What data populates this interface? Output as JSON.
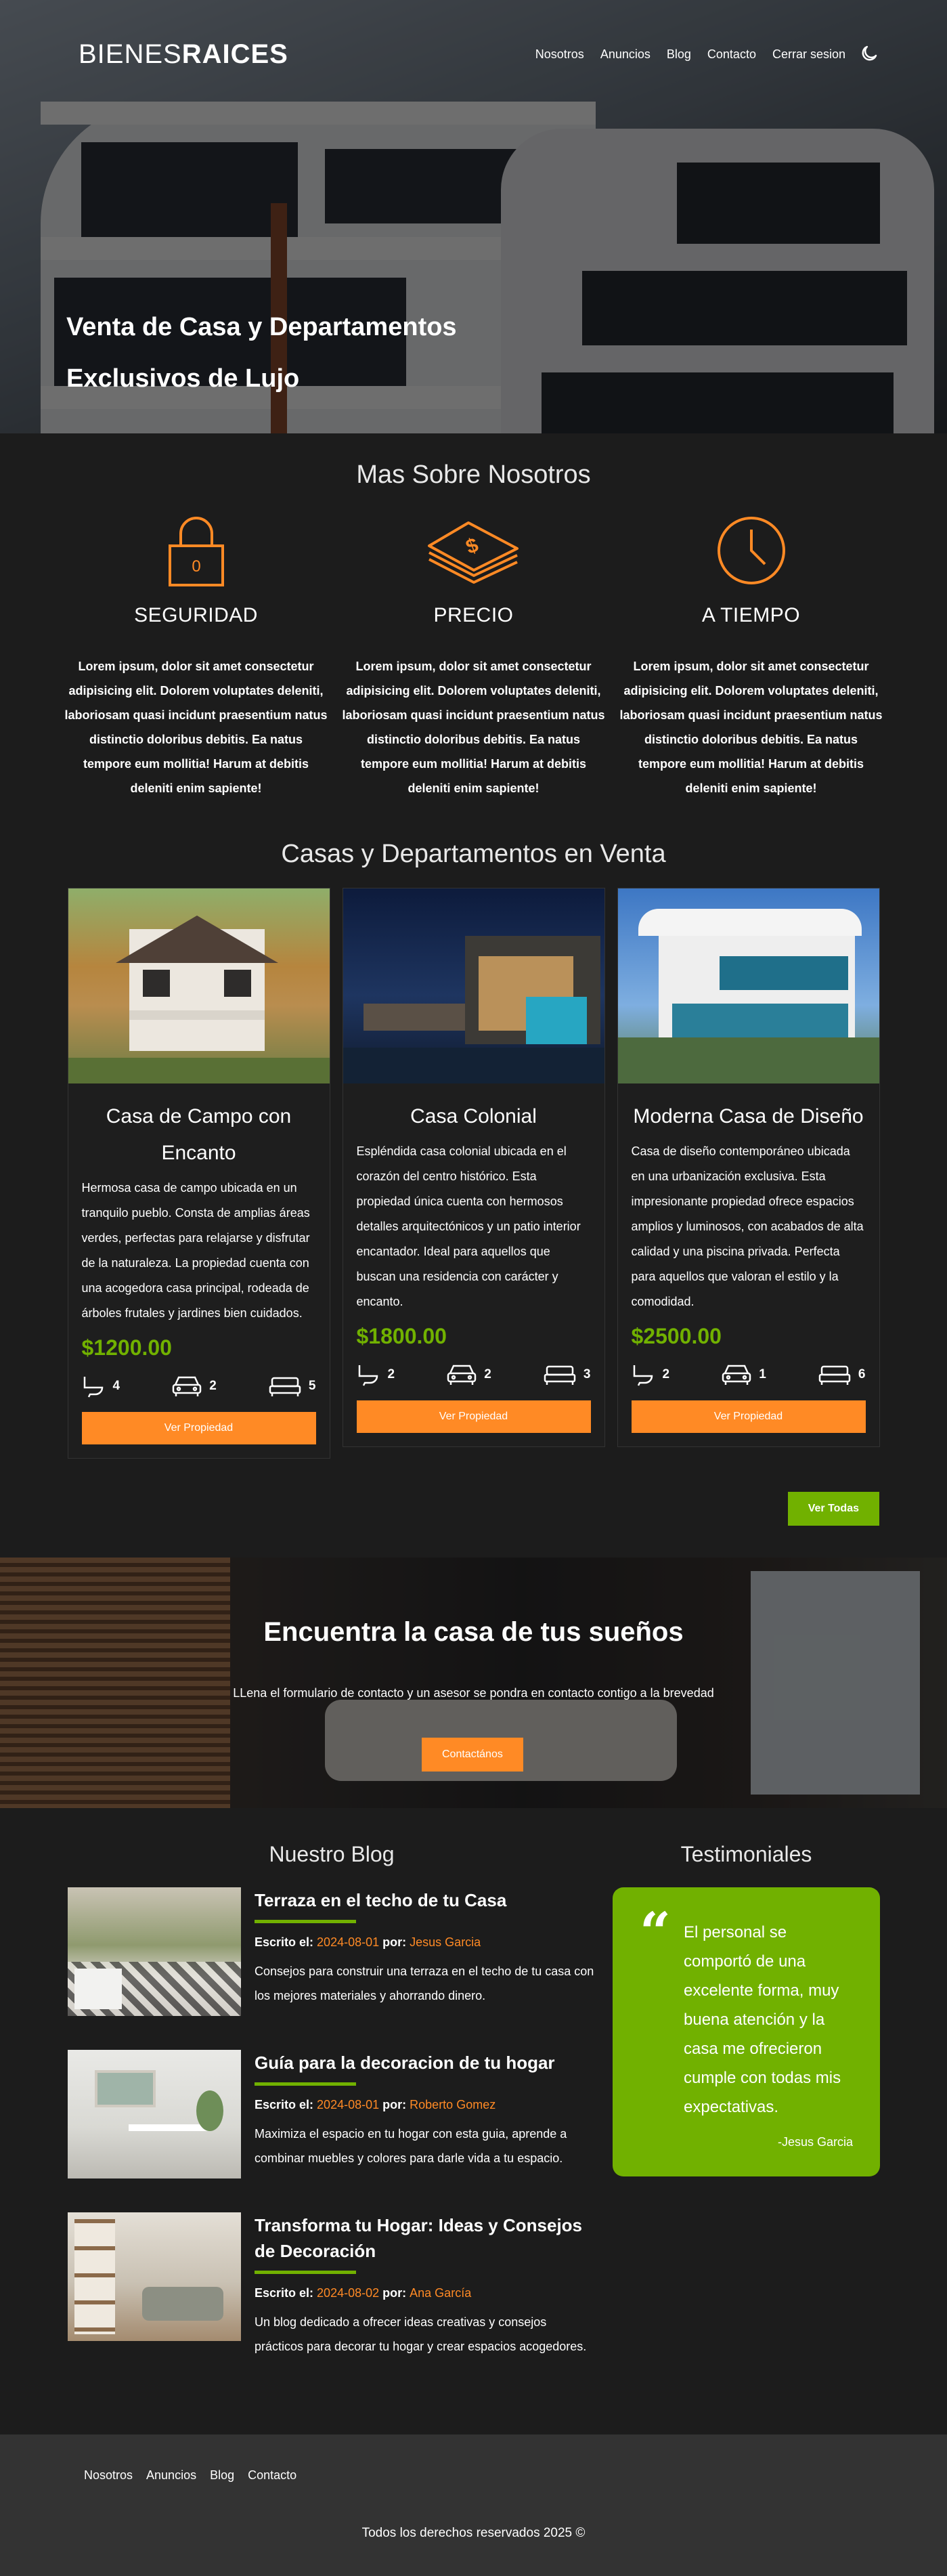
{
  "header": {
    "logo_light": "BIENES",
    "logo_bold": "RAICES",
    "nav": [
      "Nosotros",
      "Anuncios",
      "Blog",
      "Contacto",
      "Cerrar sesion"
    ],
    "theme_toggle_icon": "moon-icon",
    "headline_line1": "Venta de Casa y Departamentos",
    "headline_line2": "Exclusivos de Lujo"
  },
  "about": {
    "title": "Mas Sobre Nosotros",
    "items": [
      {
        "icon": "lock-icon",
        "title": "SEGURIDAD",
        "text": "Lorem ipsum, dolor sit amet consectetur adipisicing elit. Dolorem voluptates deleniti, laboriosam quasi incidunt praesentium natus distinctio doloribus debitis. Ea natus tempore eum mollitia! Harum at debitis deleniti enim sapiente!"
      },
      {
        "icon": "money-icon",
        "title": "PRECIO",
        "text": "Lorem ipsum, dolor sit amet consectetur adipisicing elit. Dolorem voluptates deleniti, laboriosam quasi incidunt praesentium natus distinctio doloribus debitis. Ea natus tempore eum mollitia! Harum at debitis deleniti enim sapiente!"
      },
      {
        "icon": "clock-icon",
        "title": "A TIEMPO",
        "text": "Lorem ipsum, dolor sit amet consectetur adipisicing elit. Dolorem voluptates deleniti, laboriosam quasi incidunt praesentium natus distinctio doloribus debitis. Ea natus tempore eum mollitia! Harum at debitis deleniti enim sapiente!"
      }
    ]
  },
  "listings": {
    "title": "Casas y Departamentos en Venta",
    "cards": [
      {
        "title": "Casa de Campo con Encanto",
        "description": "Hermosa casa de campo ubicada en un tranquilo pueblo. Consta de amplias áreas verdes, perfectas para relajarse y disfrutar de la naturaleza. La propiedad cuenta con una acogedora casa principal, rodeada de árboles frutales y jardines bien cuidados.",
        "price": "$1200.00",
        "baths": "4",
        "parking": "2",
        "beds": "5",
        "button": "Ver Propiedad"
      },
      {
        "title": "Casa Colonial",
        "description": "Espléndida casa colonial ubicada en el corazón del centro histórico. Esta propiedad única cuenta con hermosos detalles arquitectónicos y un patio interior encantador. Ideal para aquellos que buscan una residencia con carácter y encanto.",
        "price": "$1800.00",
        "baths": "2",
        "parking": "2",
        "beds": "3",
        "button": "Ver Propiedad"
      },
      {
        "title": "Moderna Casa de Diseño",
        "description": "Casa de diseño contemporáneo ubicada en una urbanización exclusiva. Esta impresionante propiedad ofrece espacios amplios y luminosos, con acabados de alta calidad y una piscina privada. Perfecta para aquellos que valoran el estilo y la comodidad.",
        "price": "$2500.00",
        "baths": "2",
        "parking": "1",
        "beds": "6",
        "button": "Ver Propiedad"
      }
    ],
    "view_all": "Ver Todas"
  },
  "cta": {
    "title": "Encuentra la casa de tus sueños",
    "text": "LLena el formulario de contacto y un asesor se pondra en contacto contigo a la brevedad",
    "button": "Contactános"
  },
  "blog": {
    "title": "Nuestro Blog",
    "written_label": "Escrito el:",
    "by_label": "por:",
    "entries": [
      {
        "title": "Terraza en el techo de tu Casa",
        "date": "2024-08-01",
        "author": "Jesus Garcia",
        "text": "Consejos para construir una terraza en el techo de tu casa con los mejores materiales y ahorrando dinero."
      },
      {
        "title": "Guía para la decoracion de tu hogar",
        "date": "2024-08-01",
        "author": "Roberto Gomez",
        "text": "Maximiza el espacio en tu hogar con esta guia, aprende a combinar muebles y colores para darle vida a tu espacio."
      },
      {
        "title": "Transforma tu Hogar: Ideas y Consejos de Decoración",
        "date": "2024-08-02",
        "author": "Ana García",
        "text": "Un blog dedicado a ofrecer ideas creativas y consejos prácticos para decorar tu hogar y crear espacios acogedores."
      }
    ]
  },
  "testimonials": {
    "title": "Testimoniales",
    "quote_mark": "“",
    "text": "El personal se comportó de una excelente forma, muy buena atención y la casa me ofrecieron cumple con todas mis expectativas.",
    "author": "-Jesus Garcia"
  },
  "footer": {
    "links": [
      "Nosotros",
      "Anuncios",
      "Blog",
      "Contacto"
    ],
    "copyright": "Todos los derechos reservados 2025 ©"
  },
  "colors": {
    "accent_orange": "#ff8a25",
    "accent_green": "#71b100",
    "background": "#1c1c1c",
    "footer": "#333333"
  }
}
